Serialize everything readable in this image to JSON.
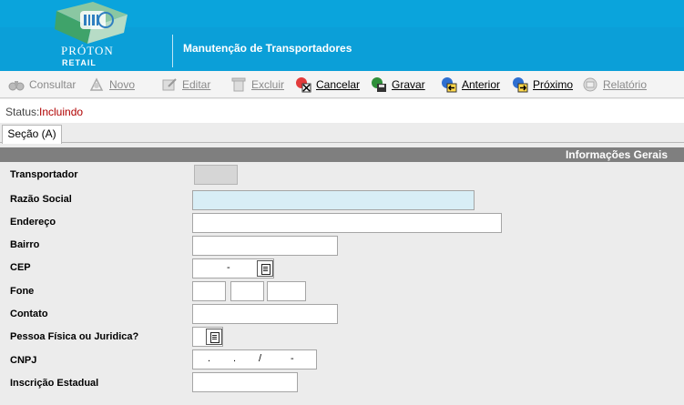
{
  "header": {
    "logo_line1": "PRÓTON",
    "logo_line2": "RETAIL",
    "title": "Manutenção de Transportadores"
  },
  "toolbar": {
    "consultar": "Consultar",
    "novo": "Novo",
    "editar": "Editar",
    "excluir": "Excluir",
    "cancelar": "Cancelar",
    "gravar": "Gravar",
    "anterior": "Anterior",
    "proximo": "Próximo",
    "relatorio": "Relatório"
  },
  "status": {
    "label": "Status:",
    "value": "Incluindo"
  },
  "tabs": [
    "Seção (A)"
  ],
  "section": {
    "title": "Informações Gerais"
  },
  "form": {
    "transportador": "Transportador",
    "razao_social": "Razão Social",
    "endereco": "Endereço",
    "bairro": "Bairro",
    "cep": "CEP",
    "cep_mask": "-",
    "fone": "Fone",
    "contato": "Contato",
    "pessoa": "Pessoa Física ou Juridica?",
    "cnpj": "CNPJ",
    "cnpj_mask_1": ".",
    "cnpj_mask_2": ".",
    "cnpj_mask_3": "/",
    "cnpj_mask_4": "-",
    "inscricao": "Inscrição Estadual"
  },
  "colors": {
    "header": "#0b9fd8",
    "status_value": "#b00000",
    "section_bar": "#7f7f7f",
    "highlight_field": "#d8eef6"
  }
}
